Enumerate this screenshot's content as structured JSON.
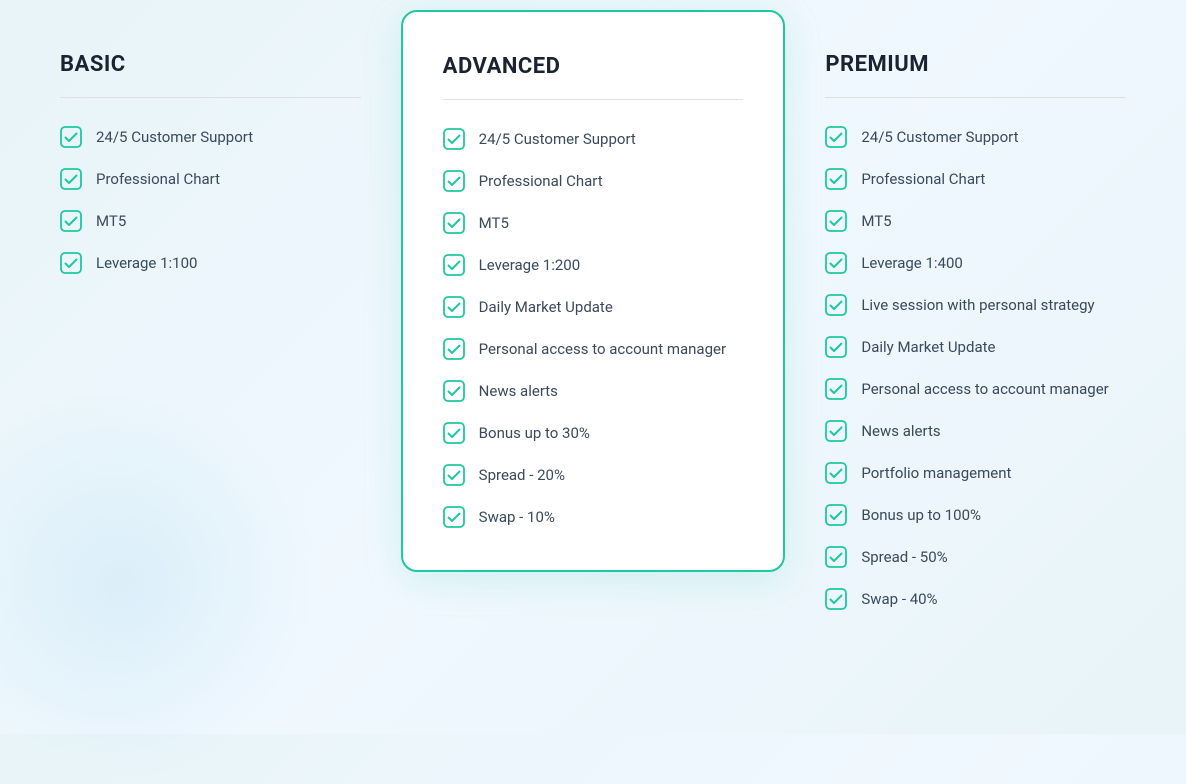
{
  "plans": [
    {
      "id": "basic",
      "title": "BASIC",
      "highlighted": false,
      "features": [
        "24/5 Customer Support",
        "Professional Chart",
        "MT5",
        "Leverage 1:100"
      ]
    },
    {
      "id": "advanced",
      "title": "ADVANCED",
      "highlighted": true,
      "features": [
        "24/5 Customer Support",
        "Professional Chart",
        "MT5",
        "Leverage 1:200",
        "Daily Market Update",
        "Personal access to account manager",
        "News alerts",
        "Bonus up to 30%",
        "Spread - 20%",
        "Swap - 10%"
      ]
    },
    {
      "id": "premium",
      "title": "PREMIUM",
      "highlighted": false,
      "features": [
        "24/5 Customer Support",
        "Professional Chart",
        "MT5",
        "Leverage 1:400",
        "Live session with personal strategy",
        "Daily Market Update",
        "Personal access to account manager",
        "News alerts",
        "Portfolio management",
        "Bonus up to 100%",
        "Spread - 50%",
        "Swap - 40%"
      ]
    }
  ],
  "checkIcon": "check",
  "colors": {
    "teal": "#1ec8a0",
    "title": "#1a2332",
    "featureText": "#3a4a5c"
  }
}
